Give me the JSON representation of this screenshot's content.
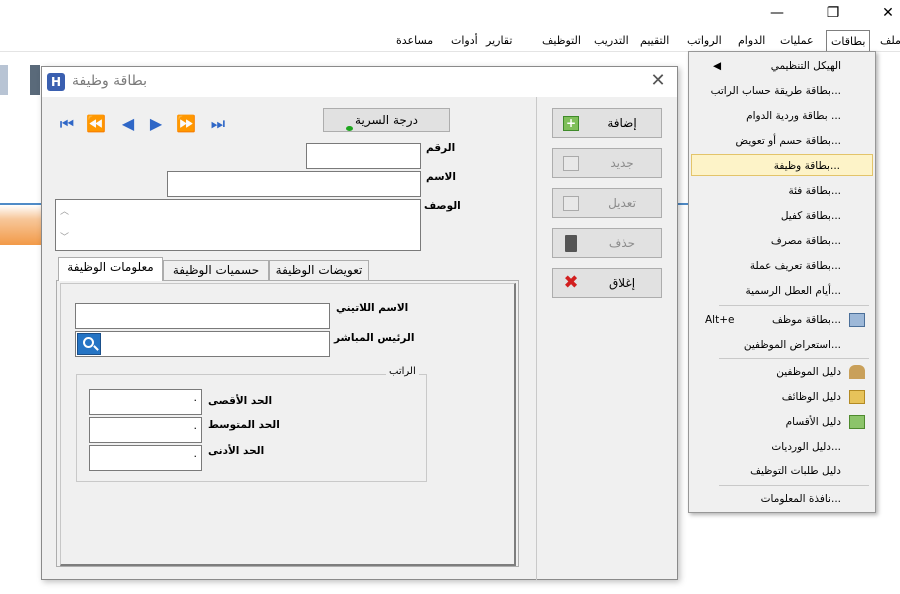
{
  "window": {
    "minimize": "—",
    "restore": "❐",
    "close": "✕"
  },
  "menubar": {
    "items": [
      "ملف",
      "بطاقات",
      "عمليات",
      "الدوام",
      "الرواتب",
      "التقييم",
      "التدريب",
      "التوظيف",
      "تقارير",
      "أدوات",
      "مساعدة"
    ]
  },
  "dialog": {
    "title": "بطاقة وظيفة",
    "icon_label": "H",
    "close": "✕",
    "nav": [
      "⏮",
      "⏪",
      "◀",
      "▶",
      "⏩",
      "⏭"
    ],
    "secrecy_button": "درجة السرية",
    "fields": {
      "number_label": "الرقم",
      "number_value": "",
      "name_label": "الاسم",
      "name_value": "",
      "description_label": "الوصف",
      "description_value": ""
    },
    "buttons": {
      "add": "إضافة",
      "new": "جديد",
      "edit": "تعديل",
      "delete": "حذف",
      "close": "إغلاق"
    },
    "tabs": [
      "معلومات الوظيفة",
      "حسميات الوظيفة",
      "تعويضات الوظيفة"
    ],
    "job_info": {
      "latin_name_label": "الاسم اللاتيني",
      "latin_name_value": "",
      "manager_label": "الرئيس المباشر",
      "manager_value": "",
      "salary_group": "الراتب",
      "max_label": "الحد الأقصى",
      "max_value": "·",
      "mid_label": "الحد المتوسط",
      "mid_value": "·",
      "min_label": "الحد الأدنى",
      "min_value": "·"
    }
  },
  "menu": {
    "items": [
      {
        "label": "الهيكل التنظيمي",
        "submenu": "◀"
      },
      {
        "label": "بطاقة طريقة حساب الراتب..."
      },
      {
        "label": "بطاقة وردية الدوام ..."
      },
      {
        "label": "بطاقة حسم أو تعويض..."
      },
      {
        "label": "بطاقة وظيفة..."
      },
      {
        "label": "بطاقة فئة..."
      },
      {
        "label": "بطاقة كفيل..."
      },
      {
        "label": "بطاقة مصرف..."
      },
      {
        "label": "بطاقة تعريف عملة..."
      },
      {
        "label": "أيام العطل الرسمية..."
      },
      {
        "label": "بطاقة موظف...",
        "shortcut": "Alt+e"
      },
      {
        "label": "استعراض الموظفين..."
      },
      {
        "label": "دليل الموظفين"
      },
      {
        "label": "دليل الوظائف"
      },
      {
        "label": "دليل الأقسام"
      },
      {
        "label": "دليل الورديات..."
      },
      {
        "label": "دليل طلبات التوظيف"
      },
      {
        "label": "نافذة المعلومات..."
      }
    ]
  },
  "colors": {
    "highlight": "#fdf3c8",
    "nav_blue": "#2f67c7"
  }
}
